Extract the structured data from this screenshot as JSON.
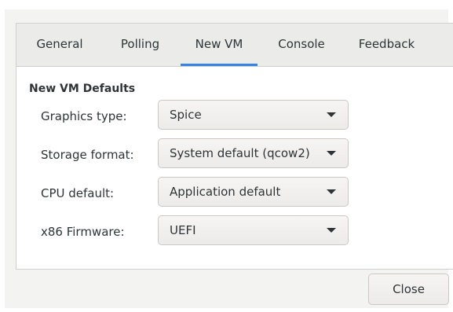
{
  "tabs": [
    {
      "label": "General",
      "active": false
    },
    {
      "label": "Polling",
      "active": false
    },
    {
      "label": "New VM",
      "active": true
    },
    {
      "label": "Console",
      "active": false
    },
    {
      "label": "Feedback",
      "active": false
    }
  ],
  "section": {
    "title": "New VM Defaults"
  },
  "fields": [
    {
      "label": "Graphics type:",
      "value": "Spice"
    },
    {
      "label": "Storage format:",
      "value": "System default (qcow2)"
    },
    {
      "label": "CPU default:",
      "value": "Application default"
    },
    {
      "label": "x86 Firmware:",
      "value": "UEFI"
    }
  ],
  "actions": {
    "close_label": "Close"
  },
  "colors": {
    "accent": "#3584e4",
    "text": "#2e3436",
    "tab_bar": "#ebebea",
    "window_bg": "#f3f3f2"
  },
  "icons": {
    "dropdown": "chevron-down-icon"
  }
}
